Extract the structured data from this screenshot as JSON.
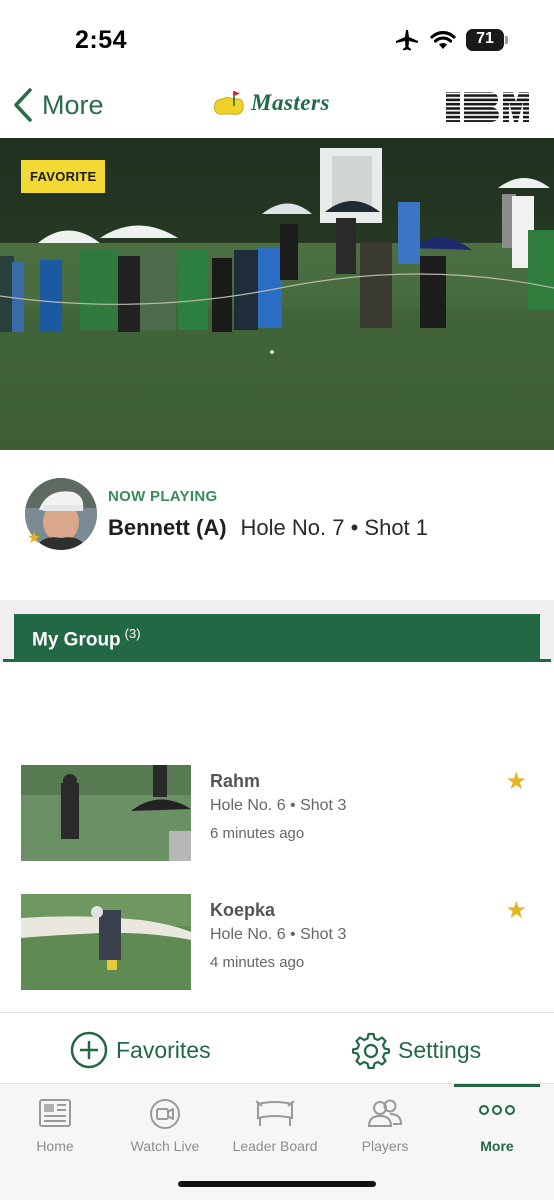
{
  "status_bar": {
    "time": "2:54",
    "battery_level": "71",
    "battery_fraction": 0.71
  },
  "header": {
    "back_label": "More",
    "logo_text": "Masters",
    "sponsor_logo": "IBM"
  },
  "video": {
    "badge": "FAVORITE"
  },
  "now_playing": {
    "label": "NOW PLAYING",
    "player": "Bennett (A)",
    "detail": "Hole No. 7 • Shot 1"
  },
  "group": {
    "title": "My Group",
    "count": "(3)"
  },
  "shots": [
    {
      "player": "Rahm",
      "detail": "Hole No. 6 • Shot 3",
      "time": "6 minutes ago",
      "favorite": true
    },
    {
      "player": "Koepka",
      "detail": "Hole No. 6 • Shot 3",
      "time": "4 minutes ago",
      "favorite": true
    }
  ],
  "actions": {
    "favorites": "Favorites",
    "settings": "Settings"
  },
  "tabs": [
    {
      "label": "Home",
      "icon": "newspaper-icon"
    },
    {
      "label": "Watch Live",
      "icon": "video-camera-icon"
    },
    {
      "label": "Leader Board",
      "icon": "leaderboard-icon"
    },
    {
      "label": "Players",
      "icon": "players-icon"
    },
    {
      "label": "More",
      "icon": "more-dots-icon",
      "active": true
    }
  ],
  "colors": {
    "brand_green": "#236845",
    "accent_yellow": "#f4d934",
    "star": "#e8b320"
  }
}
